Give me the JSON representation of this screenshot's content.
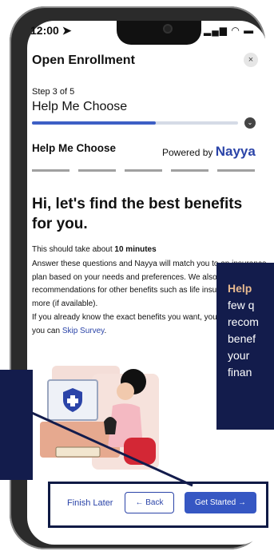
{
  "status_bar": {
    "time": "12:00",
    "icons": "signal-wifi-battery"
  },
  "header": {
    "title": "Open Enrollment",
    "close": "×"
  },
  "stepper": {
    "step": "Step 3 of 5",
    "subtitle": "Help Me Choose",
    "progress": 0.6
  },
  "nayya": {
    "section_title": "Help Me Choose",
    "powered_by": "Powered by",
    "brand": "Nayya",
    "tabs": 5
  },
  "content": {
    "hero": "Hi, let's find the best benefits for you.",
    "time_note_prefix": "This should take about",
    "time_note_bold": "10 minutes",
    "para1": "Answer these questions and Nayya will match you to an insurance plan based on your needs and preferences. We also give recommendations for other benefits such as life insurance and more (if available).",
    "para2_prefix": "If you already know the exact benefits you want, you can enroll in, you can",
    "para2_link": "Skip Survey",
    "para2_suffix": "."
  },
  "footer": {
    "finish_later": "Finish Later",
    "back": "← Back",
    "get_started": "Get Started →"
  },
  "callout_right": {
    "bold": "Help",
    "text": "few q recom benef your finan"
  },
  "colors": {
    "primary": "#2b44a8",
    "button": "#3657c3",
    "navy": "#131c4c",
    "callout_accent": "#e7b98f"
  }
}
